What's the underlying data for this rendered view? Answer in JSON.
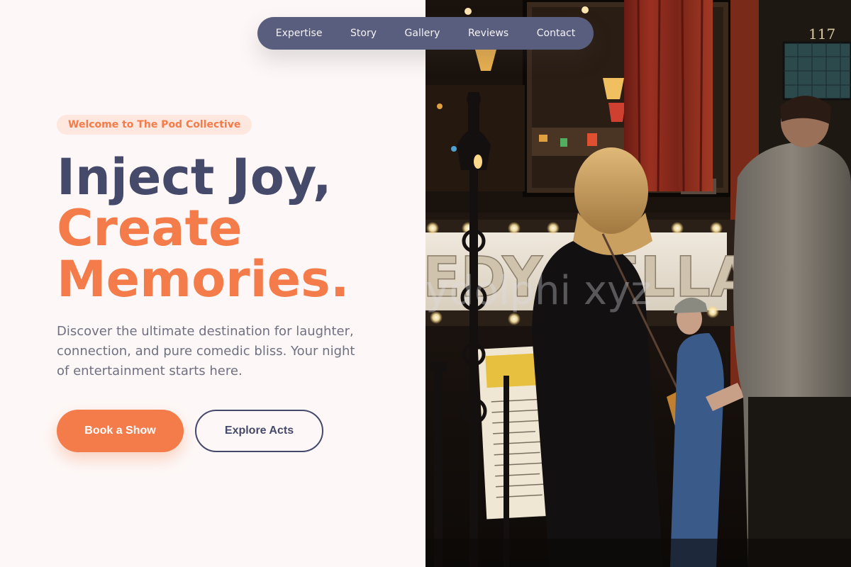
{
  "nav": {
    "items": [
      {
        "label": "Expertise"
      },
      {
        "label": "Story"
      },
      {
        "label": "Gallery"
      },
      {
        "label": "Reviews"
      },
      {
        "label": "Contact"
      }
    ]
  },
  "hero": {
    "badge": "Welcome to The Pod Collective",
    "headline_line1": "Inject Joy,",
    "headline_line2": "Create",
    "headline_line3": "Memories.",
    "description": "Discover the ultimate destination for laughter, connection, and pure comedic bliss. Your night of entertainment starts here.",
    "primary_button": "Book a Show",
    "secondary_button": "Explore Acts"
  },
  "photo": {
    "watermark": "ydolphi xyz",
    "address_number": "117",
    "sign_text": "EDY CELLAR"
  },
  "colors": {
    "accent": "#f47b4a",
    "dark": "#45496a",
    "nav_bg": "#5a5e7e",
    "badge_bg": "#fde7df",
    "page_bg": "#fdf8f7"
  }
}
